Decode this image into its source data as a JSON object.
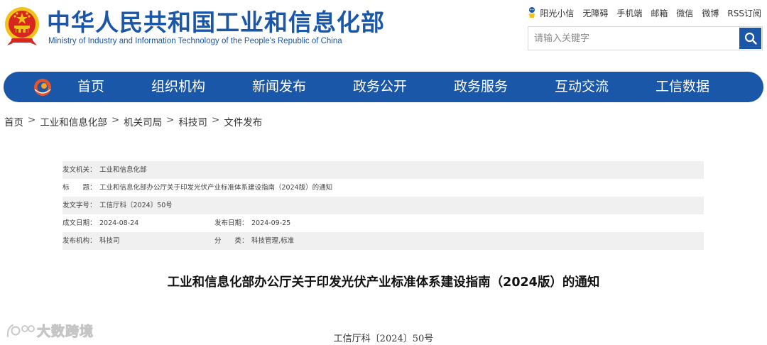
{
  "header": {
    "title_cn": "中华人民共和国工业和信息化部",
    "title_en": "Ministry of Industry and Information Technology of the People's Republic of China"
  },
  "toplinks": [
    "阳光小信",
    "无障碍",
    "手机端",
    "邮箱",
    "微信",
    "微博",
    "RSS订阅"
  ],
  "search": {
    "placeholder": "请输入关键字"
  },
  "nav": [
    "首页",
    "组织机构",
    "新闻发布",
    "政务公开",
    "政务服务",
    "互动交流",
    "工信数据"
  ],
  "breadcrumb": [
    "首页",
    "工业和信息化部",
    "机关司局",
    "科技司",
    "文件发布"
  ],
  "meta": {
    "issuer_label": "发文机关：",
    "issuer": "工业和信息化部",
    "title_label": "标　　题：",
    "title": "工业和信息化部办公厅关于印发光伏产业标准体系建设指南（2024版）的通知",
    "docno_label": "发文字号：",
    "docno": "工信厅科〔2024〕50号",
    "written_label": "成文日期：",
    "written": "2024-08-24",
    "published_label": "发布日期：",
    "published": "2024-09-25",
    "org_label": "发布机构：",
    "org": "科技司",
    "category_label": "分　　类：",
    "category": "科技管理,标准"
  },
  "article": {
    "title": "工业和信息化部办公厅关于印发光伏产业标准体系建设指南（2024版）的通知",
    "docno": "工信厅科〔2024〕50号"
  },
  "watermark": {
    "text": "大数跨境"
  },
  "colors": {
    "brand_blue": "#1a57a8",
    "row_shade": "#f0f0f0",
    "emblem_red": "#d7261e",
    "emblem_gold": "#f2c21a"
  },
  "icons": {
    "emblem": "national-emblem-icon",
    "mascot": "mascot-icon",
    "search": "search-icon",
    "nav_logo": "miit-logo-icon",
    "watermark": "watermark-logo-icon"
  }
}
